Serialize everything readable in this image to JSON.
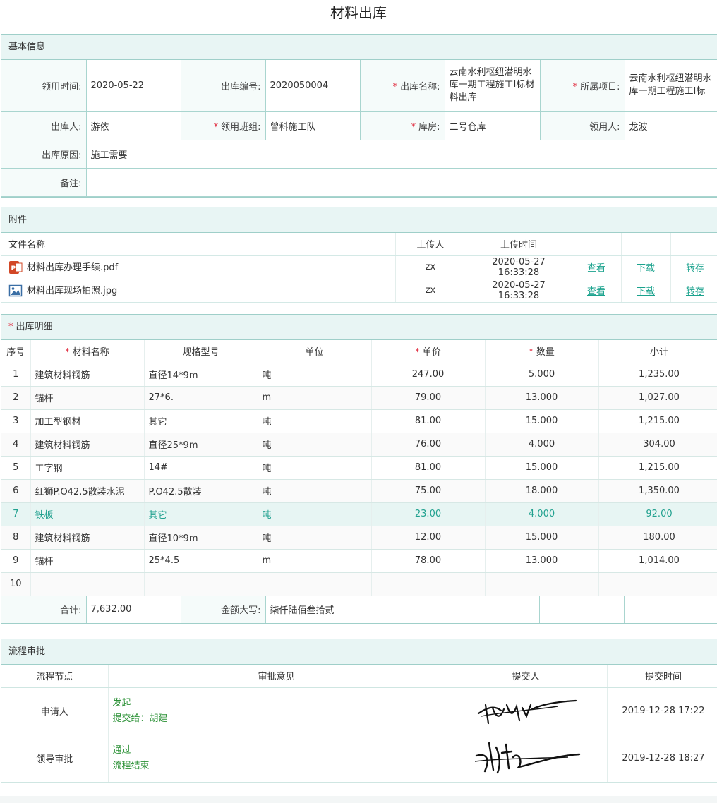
{
  "title": "材料出库",
  "basic": {
    "header": "基本信息",
    "fields": [
      {
        "label": "领用时间:",
        "value": "2020-05-22",
        "required": false
      },
      {
        "label": "出库编号:",
        "value": "2020050004",
        "required": false
      },
      {
        "label": "出库名称:",
        "value": "云南水利枢纽潜明水库一期工程施工I标材料出库",
        "required": true
      },
      {
        "label": "所属项目:",
        "value": "云南水利枢纽潜明水库一期工程施工I标",
        "required": true
      },
      {
        "label": "出库人:",
        "value": "游依",
        "required": false
      },
      {
        "label": "领用班组:",
        "value": "曾科施工队",
        "required": true
      },
      {
        "label": "库房:",
        "value": "二号仓库",
        "required": true
      },
      {
        "label": "领用人:",
        "value": "龙波",
        "required": false
      },
      {
        "label": "出库原因:",
        "value": "施工需要",
        "required": false
      },
      {
        "label": "备注:",
        "value": "",
        "required": false
      }
    ]
  },
  "attachments": {
    "header": "附件",
    "columns": [
      "文件名称",
      "上传人",
      "上传时间"
    ],
    "actions": [
      "查看",
      "下载",
      "转存"
    ],
    "files": [
      {
        "name": "材料出库办理手续.pdf",
        "uploader": "zx",
        "time": "2020-05-27 16:33:28",
        "icon": "pdf-icon"
      },
      {
        "name": "材料出库现场拍照.jpg",
        "uploader": "zx",
        "time": "2020-05-27 16:33:28",
        "icon": "image-icon"
      }
    ]
  },
  "details": {
    "header": "出库明细",
    "columns": [
      "序号",
      "材料名称",
      "规格型号",
      "单位",
      "单价",
      "数量",
      "小计"
    ],
    "rows": [
      [
        "1",
        "建筑材料钢筋",
        "直径14*9m",
        "吨",
        "247.00",
        "5.000",
        "1,235.00"
      ],
      [
        "2",
        "锚杆",
        "27*6.",
        "m",
        "79.00",
        "13.000",
        "1,027.00"
      ],
      [
        "3",
        "加工型钢材",
        "其它",
        "吨",
        "81.00",
        "15.000",
        "1,215.00"
      ],
      [
        "4",
        "建筑材料钢筋",
        "直径25*9m",
        "吨",
        "76.00",
        "4.000",
        "304.00"
      ],
      [
        "5",
        "工字钢",
        "14#",
        "吨",
        "81.00",
        "15.000",
        "1,215.00"
      ],
      [
        "6",
        "红狮P.O42.5散装水泥",
        "P.O42.5散装",
        "吨",
        "75.00",
        "18.000",
        "1,350.00"
      ],
      [
        "7",
        "铁板",
        "其它",
        "吨",
        "23.00",
        "4.000",
        "92.00"
      ],
      [
        "8",
        "建筑材料钢筋",
        "直径10*9m",
        "吨",
        "12.00",
        "15.000",
        "180.00"
      ],
      [
        "9",
        "锚杆",
        "25*4.5",
        "m",
        "78.00",
        "13.000",
        "1,014.00"
      ],
      [
        "10",
        "",
        "",
        "",
        "",
        "",
        ""
      ]
    ],
    "total_label": "合计:",
    "total_value": "7,632.00",
    "uppercase_label": "金额大写:",
    "uppercase_value": "柒仟陆佰叁拾贰"
  },
  "flow": {
    "header": "流程审批",
    "columns": [
      "流程节点",
      "审批意见",
      "提交人",
      "提交时间"
    ],
    "rows": [
      {
        "node": "申请人",
        "opinion1": "发起",
        "opinion2": "提交给：胡建",
        "time": "2019-12-28 17:22"
      },
      {
        "node": "领导审批",
        "opinion1": "通过",
        "opinion2": "流程结束",
        "time": "2019-12-28 18:27"
      }
    ]
  },
  "colors": {
    "accent": "#1aa28d",
    "border": "#9fcfc9",
    "header_bg": "#e8f5f4",
    "required": "#e0263a",
    "approve_text": "#2b9136"
  }
}
